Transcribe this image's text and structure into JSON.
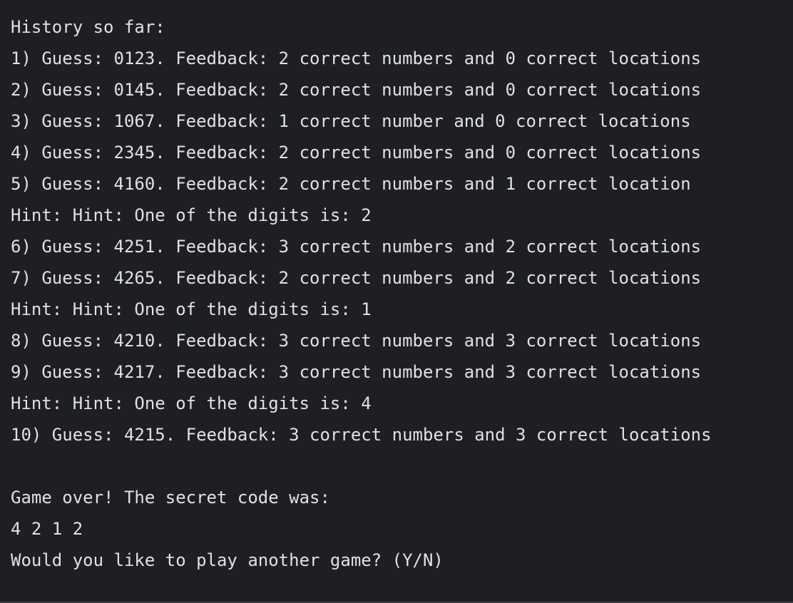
{
  "terminal": {
    "lines": [
      "History so far:",
      "1) Guess: 0123. Feedback: 2 correct numbers and 0 correct locations",
      "2) Guess: 0145. Feedback: 2 correct numbers and 0 correct locations",
      "3) Guess: 1067. Feedback: 1 correct number and 0 correct locations",
      "4) Guess: 2345. Feedback: 2 correct numbers and 0 correct locations",
      "5) Guess: 4160. Feedback: 2 correct numbers and 1 correct location",
      "Hint: Hint: One of the digits is: 2",
      "6) Guess: 4251. Feedback: 3 correct numbers and 2 correct locations",
      "7) Guess: 4265. Feedback: 2 correct numbers and 2 correct locations",
      "Hint: Hint: One of the digits is: 1",
      "8) Guess: 4210. Feedback: 3 correct numbers and 3 correct locations",
      "9) Guess: 4217. Feedback: 3 correct numbers and 3 correct locations",
      "Hint: Hint: One of the digits is: 4",
      "10) Guess: 4215. Feedback: 3 correct numbers and 3 correct locations",
      "",
      "Game over! The secret code was:",
      "4 2 1 2",
      "Would you like to play another game? (Y/N)"
    ]
  },
  "colors": {
    "background": "#1e1f22",
    "text": "#dfe1e5"
  }
}
